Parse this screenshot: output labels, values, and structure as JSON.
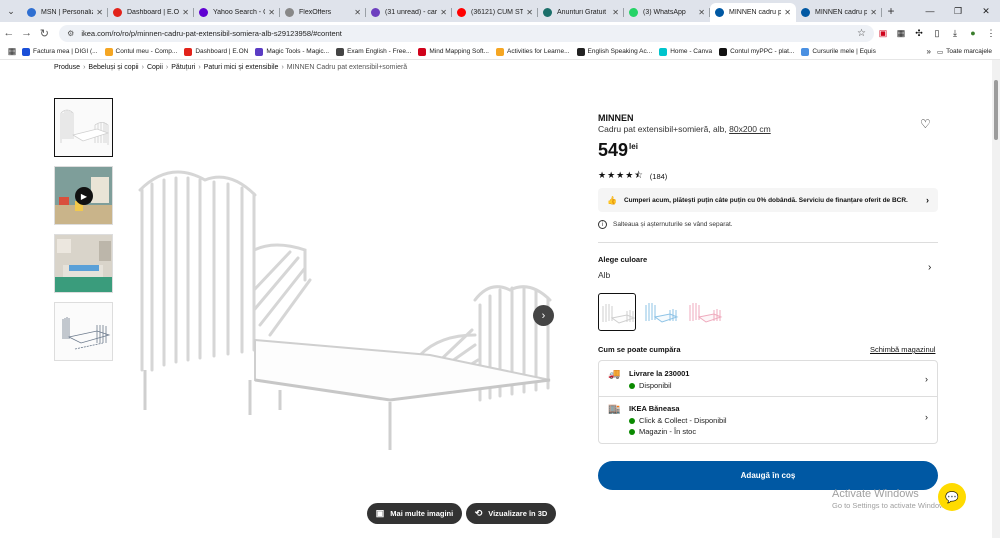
{
  "browser": {
    "tabs": [
      {
        "title": "MSN | Personaliz",
        "color": "#2f6fd1",
        "active": false
      },
      {
        "title": "Dashboard | E.ON",
        "color": "#e2231a",
        "active": false
      },
      {
        "title": "Yahoo Search - C",
        "color": "#6001d2",
        "active": false
      },
      {
        "title": "FlexOffers",
        "color": "#888888",
        "active": false
      },
      {
        "title": "(31 unread) - car",
        "color": "#6d3fbf",
        "active": false
      },
      {
        "title": "(36121) CUM STI",
        "color": "#ff0000",
        "active": false
      },
      {
        "title": "Anunturi Gratuit",
        "color": "#1b6f6a",
        "active": false
      },
      {
        "title": "(3) WhatsApp",
        "color": "#25d366",
        "active": false
      },
      {
        "title": "MINNEN cadru p",
        "color": "#0058a3",
        "active": true
      },
      {
        "title": "MINNEN cadru p",
        "color": "#0058a3",
        "active": false
      }
    ],
    "url": "ikea.com/ro/ro/p/minnen-cadru-pat-extensibil-somiera-alb-s29123958/#content",
    "bookmarks": [
      {
        "label": "Factura mea | DIGI (...",
        "color": "#1a4fd8"
      },
      {
        "label": "Contul meu - Comp...",
        "color": "#f5a623"
      },
      {
        "label": "Dashboard | E.ON",
        "color": "#e2231a"
      },
      {
        "label": "Magic Tools - Magic...",
        "color": "#5b3cc4"
      },
      {
        "label": "Exam English - Free...",
        "color": "#444444"
      },
      {
        "label": "Mind Mapping Soft...",
        "color": "#d0021b"
      },
      {
        "label": "Activities for Learne...",
        "color": "#f5a623"
      },
      {
        "label": "English Speaking Ac...",
        "color": "#222222"
      },
      {
        "label": "Home - Canva",
        "color": "#00c4cc"
      },
      {
        "label": "Contul myPPC - plat...",
        "color": "#111111"
      },
      {
        "label": "Cursurile mele | Equis",
        "color": "#4a90e2"
      }
    ],
    "all_bookmarks": "Toate marcajele"
  },
  "breadcrumbs": [
    "Produse",
    "Bebeluși și copii",
    "Copii",
    "Pătuțuri",
    "Paturi mici și extensibile",
    "MINNEN Cadru pat extensibil+somieră"
  ],
  "product": {
    "brand": "MINNEN",
    "description": "Cadru pat extensibil+somieră, alb,",
    "dimension": "80x200 cm",
    "price": "549",
    "currency": "lei",
    "rating_stars": 4.5,
    "reviews": "(184)",
    "financing": "Cumperi acum, plătești puțin câte puțin cu 0% dobândă. Serviciu de finanțare oferit de BCR.",
    "notice": "Salteaua și așternuturile se vând separat.",
    "color_label": "Alege culoare",
    "color_value": "Alb",
    "buy_label": "Cum se poate cumpăra",
    "store_link": "Schimbă magazinul",
    "delivery": {
      "title": "Livrare la 230001",
      "status": "Disponibil"
    },
    "store": {
      "title": "IKEA Băneasa",
      "line1": "Click & Collect - Disponibil",
      "line2": "Magazin - În stoc"
    },
    "add_to_cart": "Adaugă în coș"
  },
  "media": {
    "more_images": "Mai multe imagini",
    "view_3d": "Vizualizare în 3D"
  },
  "watermark": {
    "line1": "Activate Windows",
    "line2": "Go to Settings to activate Windows."
  }
}
